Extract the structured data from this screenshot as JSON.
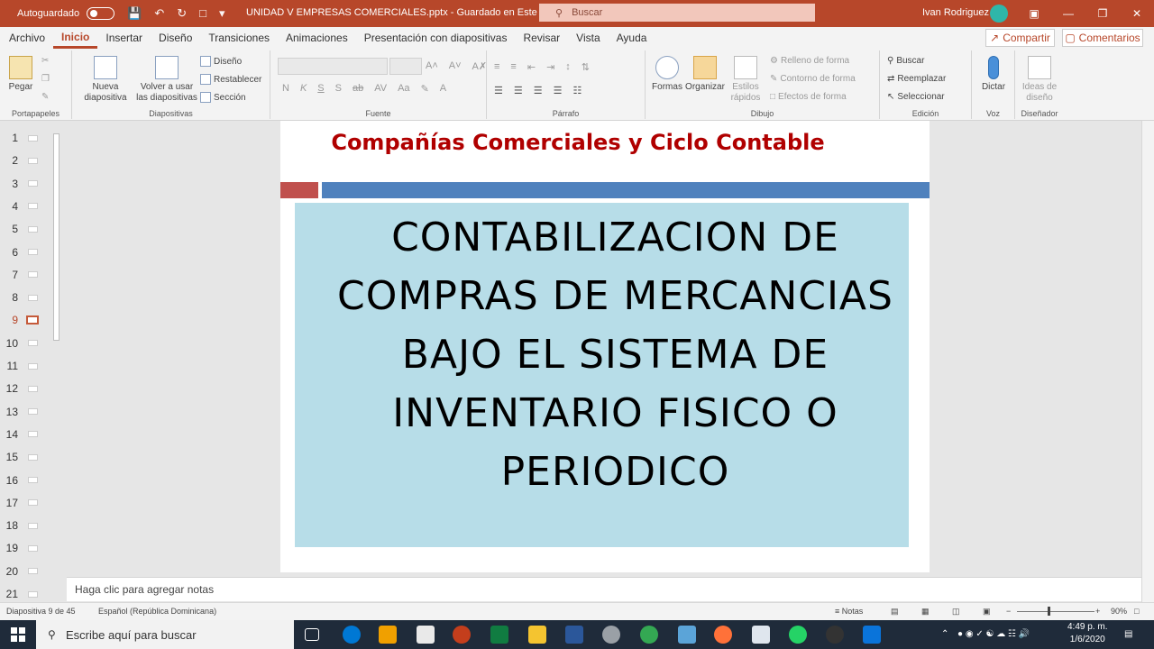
{
  "titlebar": {
    "autosave_label": "Autoguardado",
    "document_title": "UNIDAD V EMPRESAS COMERCIALES.pptx  -  Guardado en Este PC",
    "search_placeholder": "Buscar",
    "user_name": "Ivan Rodriguez"
  },
  "menu": {
    "tabs": [
      "Archivo",
      "Inicio",
      "Insertar",
      "Diseño",
      "Transiciones",
      "Animaciones",
      "Presentación con diapositivas",
      "Revisar",
      "Vista",
      "Ayuda"
    ],
    "active_tab": "Inicio",
    "share_label": "Compartir",
    "comments_label": "Comentarios"
  },
  "ribbon": {
    "portapapeles": {
      "label": "Portapapeles",
      "paste": "Pegar"
    },
    "diapositivas": {
      "label": "Diapositivas",
      "new_slide": "Nueva diapositiva",
      "reuse": "Volver a usar las diapositivas",
      "layout": "Diseño",
      "reset": "Restablecer",
      "section": "Sección"
    },
    "fuente": {
      "label": "Fuente"
    },
    "parrafo": {
      "label": "Párrafo"
    },
    "dibujo": {
      "label": "Dibujo",
      "shapes": "Formas",
      "arrange": "Organizar",
      "quick_styles": "Estilos rápidos",
      "fill": "Relleno de forma",
      "outline": "Contorno de forma",
      "effects": "Efectos de forma"
    },
    "edicion": {
      "label": "Edición",
      "find": "Buscar",
      "replace": "Reemplazar",
      "select": "Seleccionar"
    },
    "voz": {
      "label": "Voz",
      "dictate": "Dictar"
    },
    "disenador": {
      "label": "Diseñador",
      "ideas": "Ideas de diseño"
    }
  },
  "thumbnails": [
    {
      "num": "1"
    },
    {
      "num": "2"
    },
    {
      "num": "3"
    },
    {
      "num": "4"
    },
    {
      "num": "5"
    },
    {
      "num": "6"
    },
    {
      "num": "7"
    },
    {
      "num": "8"
    },
    {
      "num": "9"
    },
    {
      "num": "10"
    },
    {
      "num": "11"
    },
    {
      "num": "12"
    },
    {
      "num": "13"
    },
    {
      "num": "14"
    },
    {
      "num": "15"
    },
    {
      "num": "16"
    },
    {
      "num": "17"
    },
    {
      "num": "18"
    },
    {
      "num": "19"
    },
    {
      "num": "20"
    },
    {
      "num": "21"
    }
  ],
  "selected_slide": "9",
  "slide": {
    "title": "Compañías Comerciales y Ciclo Contable",
    "content": "CONTABILIZACION DE COMPRAS DE MERCANCIAS BAJO EL SISTEMA DE INVENTARIO FISICO O PERIODICO"
  },
  "notes_placeholder": "Haga clic para agregar notas",
  "status": {
    "slide_counter": "Diapositiva 9 de 45",
    "language": "Español (República Dominicana)",
    "notes": "Notas",
    "zoom": "90%"
  },
  "taskbar": {
    "search_placeholder": "Escribe aquí para buscar",
    "time": "4:49 p. m.",
    "date": "1/6/2020"
  }
}
